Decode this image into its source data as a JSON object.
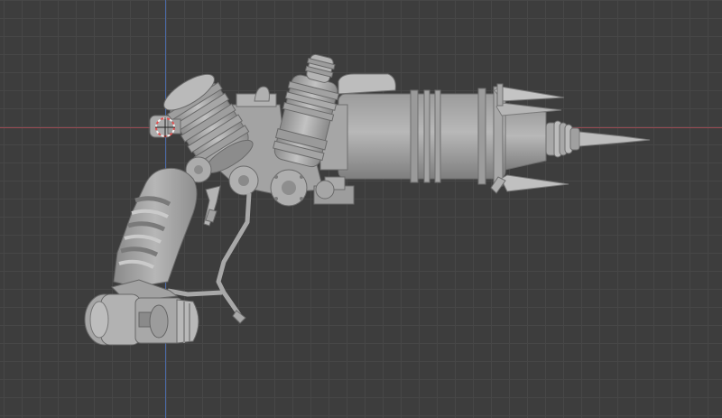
{
  "viewport": {
    "background_color": "#3d3d3d",
    "grid_color": "#474747",
    "x_axis_color": "#9a4a52",
    "y_axis_color": "#4b6aa8",
    "origin_marker_color": "#e05050"
  },
  "model": {
    "kind": "ray-gun-pistol",
    "shading": "solid",
    "base_color": "#b4b4b4",
    "shadow_color": "#7c7c7c",
    "highlight_color": "#d2d2d2"
  }
}
